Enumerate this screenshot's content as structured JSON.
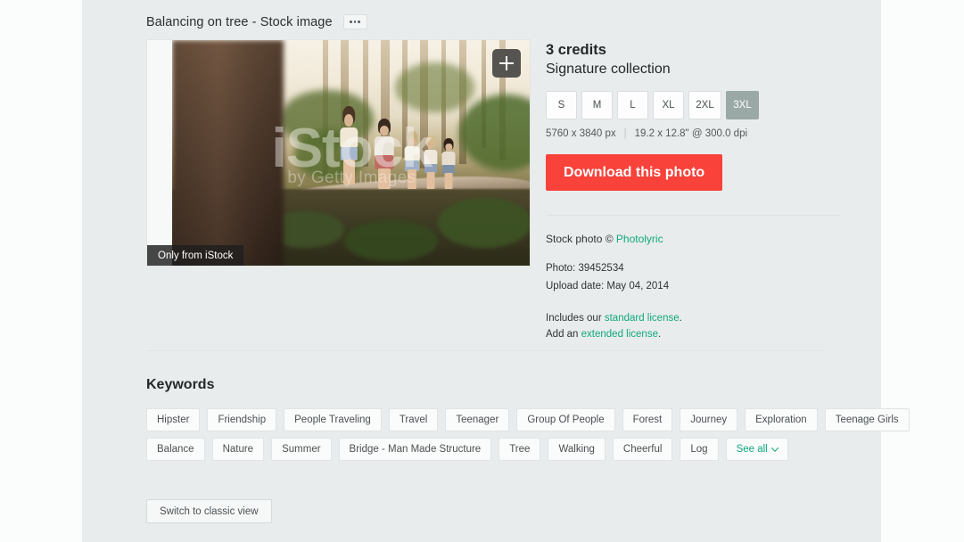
{
  "header": {
    "asset_title": "Balancing on tree - Stock image",
    "more_menu_label": "..."
  },
  "image": {
    "zoom_icon": "plus-icon",
    "badge": "Only from iStock",
    "watermark_main": "iStock",
    "watermark_sub": "by Getty Images",
    "alt_description": "Group of young friends walking in a line along a fallen log in a sunlit forest, seen past a blurred dark tree trunk in the foreground"
  },
  "buy": {
    "credits": "3 credits",
    "collection": "Signature collection",
    "sizes": [
      {
        "label": "S",
        "selected": false
      },
      {
        "label": "M",
        "selected": false
      },
      {
        "label": "L",
        "selected": false
      },
      {
        "label": "XL",
        "selected": false
      },
      {
        "label": "2XL",
        "selected": false
      },
      {
        "label": "3XL",
        "selected": true
      }
    ],
    "pixel_dimensions": "5760 x 3840 px",
    "print_dimensions": "19.2 x 12.8\" @ 300.0 dpi",
    "download_label": "Download this photo",
    "credit_prefix": "Stock photo © ",
    "contributor": "Photolyric",
    "photo_id_label": "Photo: 39452534",
    "upload_date_label": "Upload date: May 04, 2014",
    "license_includes_prefix": "Includes our ",
    "license_standard": "standard license",
    "license_includes_suffix": ".",
    "license_add_prefix": "Add an ",
    "license_extended": "extended license",
    "license_add_suffix": "."
  },
  "keywords": {
    "title": "Keywords",
    "row1": [
      "Hipster",
      "Friendship",
      "People Traveling",
      "Travel",
      "Teenager",
      "Group Of People",
      "Forest",
      "Journey",
      "Exploration",
      "Teenage Girls"
    ],
    "row2": [
      "Balance",
      "Nature",
      "Summer",
      "Bridge - Man Made Structure",
      "Tree",
      "Walking",
      "Cheerful",
      "Log"
    ],
    "see_all": "See all"
  },
  "footer": {
    "classic_view": "Switch to classic view"
  },
  "colors": {
    "accent_download": "#f9423a",
    "link_teal": "#11a87e",
    "selected_size": "#9ba9a6",
    "content_bg": "#e9ecec"
  }
}
